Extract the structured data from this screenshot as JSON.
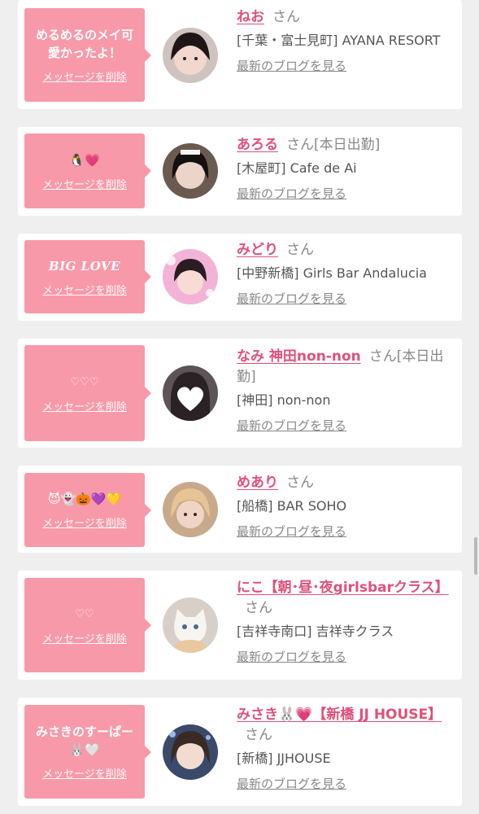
{
  "entries": [
    {
      "message": "めるめるのメイ可愛かったよ！",
      "delete_label": "メッセージを削除",
      "name": "ねお",
      "honorific": "さん",
      "status": "",
      "shop": "[千葉・富士見町] AYANA RESORT",
      "blog_label": "最新のブログを見る"
    },
    {
      "message": "🐧💗",
      "delete_label": "メッセージを削除",
      "name": "あろる",
      "honorific": "さん",
      "status": "[本日出勤]",
      "shop": "[木屋町] Cafe de Ai",
      "blog_label": "最新のブログを見る"
    },
    {
      "message": "BIG LOVE",
      "delete_label": "メッセージを削除",
      "name": "みどり",
      "honorific": "さん",
      "status": "",
      "shop": "[中野新橋] Girls Bar Andalucia",
      "blog_label": "最新のブログを見る"
    },
    {
      "message": "♡♡♡",
      "delete_label": "メッセージを削除",
      "name": "なみ 神田non-non",
      "honorific": "さん",
      "status": "[本日出勤]",
      "shop": "[神田] non-non",
      "blog_label": "最新のブログを見る"
    },
    {
      "message": "😈👻🎃💜💛",
      "delete_label": "メッセージを削除",
      "name": "めあり",
      "honorific": "さん",
      "status": "",
      "shop": "[船橋] BAR SOHO",
      "blog_label": "最新のブログを見る"
    },
    {
      "message": "♡♡",
      "delete_label": "メッセージを削除",
      "name": "にこ【朝･昼･夜girlsbarクラス】",
      "honorific": "さん",
      "status": "",
      "shop": "[吉祥寺南口] 吉祥寺クラス",
      "blog_label": "最新のブログを見る"
    },
    {
      "message": "みさきのすーぱー🐰🤍",
      "delete_label": "メッセージを削除",
      "name": "みさき🐰💗【新橋 JJ HOUSE】",
      "honorific": "さん",
      "status": "",
      "shop": "[新橋] JJHOUSE",
      "blog_label": "最新のブログを見る"
    }
  ],
  "colors": {
    "accent": "#e0507a",
    "bubble": "#f899a9",
    "background": "#efefef"
  }
}
